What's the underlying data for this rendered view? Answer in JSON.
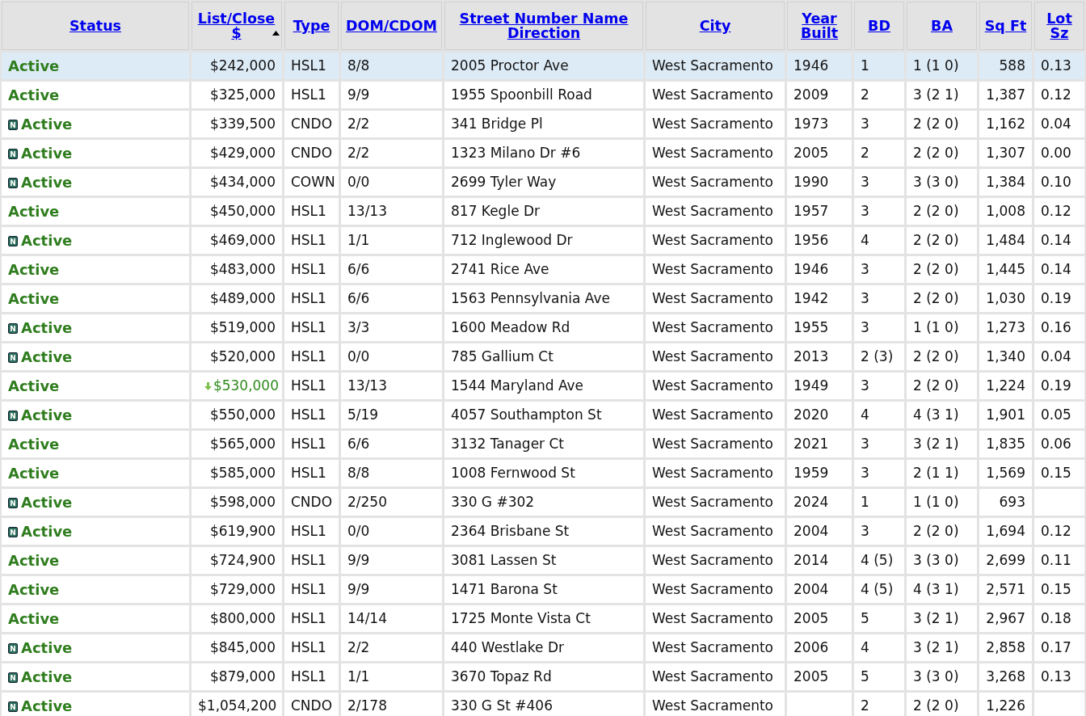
{
  "table": {
    "columns": [
      {
        "label": "Status",
        "sorted": false
      },
      {
        "label": "List/Close $",
        "sorted": true
      },
      {
        "label": "Type",
        "sorted": false
      },
      {
        "label": "DOM/CDOM",
        "sorted": false
      },
      {
        "label": "Street Number Name Direction",
        "sorted": false
      },
      {
        "label": "City",
        "sorted": false
      },
      {
        "label": "Year Built",
        "sorted": false
      },
      {
        "label": "BD",
        "sorted": false
      },
      {
        "label": "BA",
        "sorted": false
      },
      {
        "label": "Sq Ft",
        "sorted": false
      },
      {
        "label": "Lot Sz",
        "sorted": false
      }
    ],
    "rows": [
      {
        "selected": true,
        "status": "Active",
        "price": "$242,000",
        "price_drop": false,
        "type": "HSL1",
        "dom": "8/8",
        "street": "2005 Proctor Ave",
        "city": "West Sacramento",
        "year": "1946",
        "bd": "1",
        "ba": "1 (1 0)",
        "sqft": "588",
        "lot": "0.13"
      },
      {
        "selected": false,
        "status": "Active",
        "price": "$325,000",
        "price_drop": false,
        "type": "HSL1",
        "dom": "9/9",
        "street": "1955 Spoonbill Road",
        "city": "West Sacramento",
        "year": "2009",
        "bd": "2",
        "ba": "3 (2 1)",
        "sqft": "1,387",
        "lot": "0.12"
      },
      {
        "selected": false,
        "flag": "N",
        "status": "Active",
        "price": "$339,500",
        "price_drop": false,
        "type": "CNDO",
        "dom": "2/2",
        "street": "341 Bridge Pl",
        "city": "West Sacramento",
        "year": "1973",
        "bd": "3",
        "ba": "2 (2 0)",
        "sqft": "1,162",
        "lot": "0.04"
      },
      {
        "selected": false,
        "flag": "N",
        "status": "Active",
        "price": "$429,000",
        "price_drop": false,
        "type": "CNDO",
        "dom": "2/2",
        "street": "1323 Milano Dr #6",
        "city": "West Sacramento",
        "year": "2005",
        "bd": "2",
        "ba": "2 (2 0)",
        "sqft": "1,307",
        "lot": "0.00"
      },
      {
        "selected": false,
        "flag": "N",
        "status": "Active",
        "price": "$434,000",
        "price_drop": false,
        "type": "COWN",
        "dom": "0/0",
        "street": "2699 Tyler Way",
        "city": "West Sacramento",
        "year": "1990",
        "bd": "3",
        "ba": "3 (3 0)",
        "sqft": "1,384",
        "lot": "0.10"
      },
      {
        "selected": false,
        "status": "Active",
        "price": "$450,000",
        "price_drop": false,
        "type": "HSL1",
        "dom": "13/13",
        "street": "817 Kegle Dr",
        "city": "West Sacramento",
        "year": "1957",
        "bd": "3",
        "ba": "2 (2 0)",
        "sqft": "1,008",
        "lot": "0.12"
      },
      {
        "selected": false,
        "flag": "N",
        "status": "Active",
        "price": "$469,000",
        "price_drop": false,
        "type": "HSL1",
        "dom": "1/1",
        "street": "712 Inglewood Dr",
        "city": "West Sacramento",
        "year": "1956",
        "bd": "4",
        "ba": "2 (2 0)",
        "sqft": "1,484",
        "lot": "0.14"
      },
      {
        "selected": false,
        "status": "Active",
        "price": "$483,000",
        "price_drop": false,
        "type": "HSL1",
        "dom": "6/6",
        "street": "2741 Rice Ave",
        "city": "West Sacramento",
        "year": "1946",
        "bd": "3",
        "ba": "2 (2 0)",
        "sqft": "1,445",
        "lot": "0.14"
      },
      {
        "selected": false,
        "status": "Active",
        "price": "$489,000",
        "price_drop": false,
        "type": "HSL1",
        "dom": "6/6",
        "street": "1563 Pennsylvania Ave",
        "city": "West Sacramento",
        "year": "1942",
        "bd": "3",
        "ba": "2 (2 0)",
        "sqft": "1,030",
        "lot": "0.19"
      },
      {
        "selected": false,
        "flag": "N",
        "status": "Active",
        "price": "$519,000",
        "price_drop": false,
        "type": "HSL1",
        "dom": "3/3",
        "street": "1600 Meadow Rd",
        "city": "West Sacramento",
        "year": "1955",
        "bd": "3",
        "ba": "1 (1 0)",
        "sqft": "1,273",
        "lot": "0.16"
      },
      {
        "selected": false,
        "flag": "N",
        "status": "Active",
        "price": "$520,000",
        "price_drop": false,
        "type": "HSL1",
        "dom": "0/0",
        "street": "785 Gallium Ct",
        "city": "West Sacramento",
        "year": "2013",
        "bd": "2 (3)",
        "ba": "2 (2 0)",
        "sqft": "1,340",
        "lot": "0.04"
      },
      {
        "selected": false,
        "status": "Active",
        "price": "$530,000",
        "price_drop": true,
        "type": "HSL1",
        "dom": "13/13",
        "street": "1544 Maryland Ave",
        "city": "West Sacramento",
        "year": "1949",
        "bd": "3",
        "ba": "2 (2 0)",
        "sqft": "1,224",
        "lot": "0.19"
      },
      {
        "selected": false,
        "flag": "N",
        "status": "Active",
        "price": "$550,000",
        "price_drop": false,
        "type": "HSL1",
        "dom": "5/19",
        "street": "4057 Southampton St",
        "city": "West Sacramento",
        "year": "2020",
        "bd": "4",
        "ba": "4 (3 1)",
        "sqft": "1,901",
        "lot": "0.05"
      },
      {
        "selected": false,
        "status": "Active",
        "price": "$565,000",
        "price_drop": false,
        "type": "HSL1",
        "dom": "6/6",
        "street": "3132 Tanager Ct",
        "city": "West Sacramento",
        "year": "2021",
        "bd": "3",
        "ba": "3 (2 1)",
        "sqft": "1,835",
        "lot": "0.06"
      },
      {
        "selected": false,
        "status": "Active",
        "price": "$585,000",
        "price_drop": false,
        "type": "HSL1",
        "dom": "8/8",
        "street": "1008 Fernwood St",
        "city": "West Sacramento",
        "year": "1959",
        "bd": "3",
        "ba": "2 (1 1)",
        "sqft": "1,569",
        "lot": "0.15"
      },
      {
        "selected": false,
        "flag": "N",
        "status": "Active",
        "price": "$598,000",
        "price_drop": false,
        "type": "CNDO",
        "dom": "2/250",
        "street": "330 G #302",
        "city": "West Sacramento",
        "year": "2024",
        "bd": "1",
        "ba": "1 (1 0)",
        "sqft": "693"
      },
      {
        "selected": false,
        "flag": "N",
        "status": "Active",
        "price": "$619,900",
        "price_drop": false,
        "type": "HSL1",
        "dom": "0/0",
        "street": "2364 Brisbane St",
        "city": "West Sacramento",
        "year": "2004",
        "bd": "3",
        "ba": "2 (2 0)",
        "sqft": "1,694",
        "lot": "0.12"
      },
      {
        "selected": false,
        "status": "Active",
        "price": "$724,900",
        "price_drop": false,
        "type": "HSL1",
        "dom": "9/9",
        "street": "3081 Lassen St",
        "city": "West Sacramento",
        "year": "2014",
        "bd": "4 (5)",
        "ba": "3 (3 0)",
        "sqft": "2,699",
        "lot": "0.11"
      },
      {
        "selected": false,
        "status": "Active",
        "price": "$729,000",
        "price_drop": false,
        "type": "HSL1",
        "dom": "9/9",
        "street": "1471 Barona St",
        "city": "West Sacramento",
        "year": "2004",
        "bd": "4 (5)",
        "ba": "4 (3 1)",
        "sqft": "2,571",
        "lot": "0.15"
      },
      {
        "selected": false,
        "status": "Active",
        "price": "$800,000",
        "price_drop": false,
        "type": "HSL1",
        "dom": "14/14",
        "street": "1725 Monte Vista Ct",
        "city": "West Sacramento",
        "year": "2005",
        "bd": "5",
        "ba": "3 (2 1)",
        "sqft": "2,967",
        "lot": "0.18"
      },
      {
        "selected": false,
        "flag": "N",
        "status": "Active",
        "price": "$845,000",
        "price_drop": false,
        "type": "HSL1",
        "dom": "2/2",
        "street": "440 Westlake Dr",
        "city": "West Sacramento",
        "year": "2006",
        "bd": "4",
        "ba": "3 (2 1)",
        "sqft": "2,858",
        "lot": "0.17"
      },
      {
        "selected": false,
        "flag": "N",
        "status": "Active",
        "price": "$879,000",
        "price_drop": false,
        "type": "HSL1",
        "dom": "1/1",
        "street": "3670 Topaz Rd",
        "city": "West Sacramento",
        "year": "2005",
        "bd": "5",
        "ba": "3 (3 0)",
        "sqft": "3,268",
        "lot": "0.13"
      },
      {
        "selected": false,
        "flag": "N",
        "status": "Active",
        "price": "$1,054,200",
        "price_drop": false,
        "type": "CNDO",
        "dom": "2/178",
        "street": "330 G St #406",
        "city": "West Sacramento",
        "bd": "2",
        "ba": "2 (2 0)",
        "sqft": "1,226"
      }
    ]
  }
}
